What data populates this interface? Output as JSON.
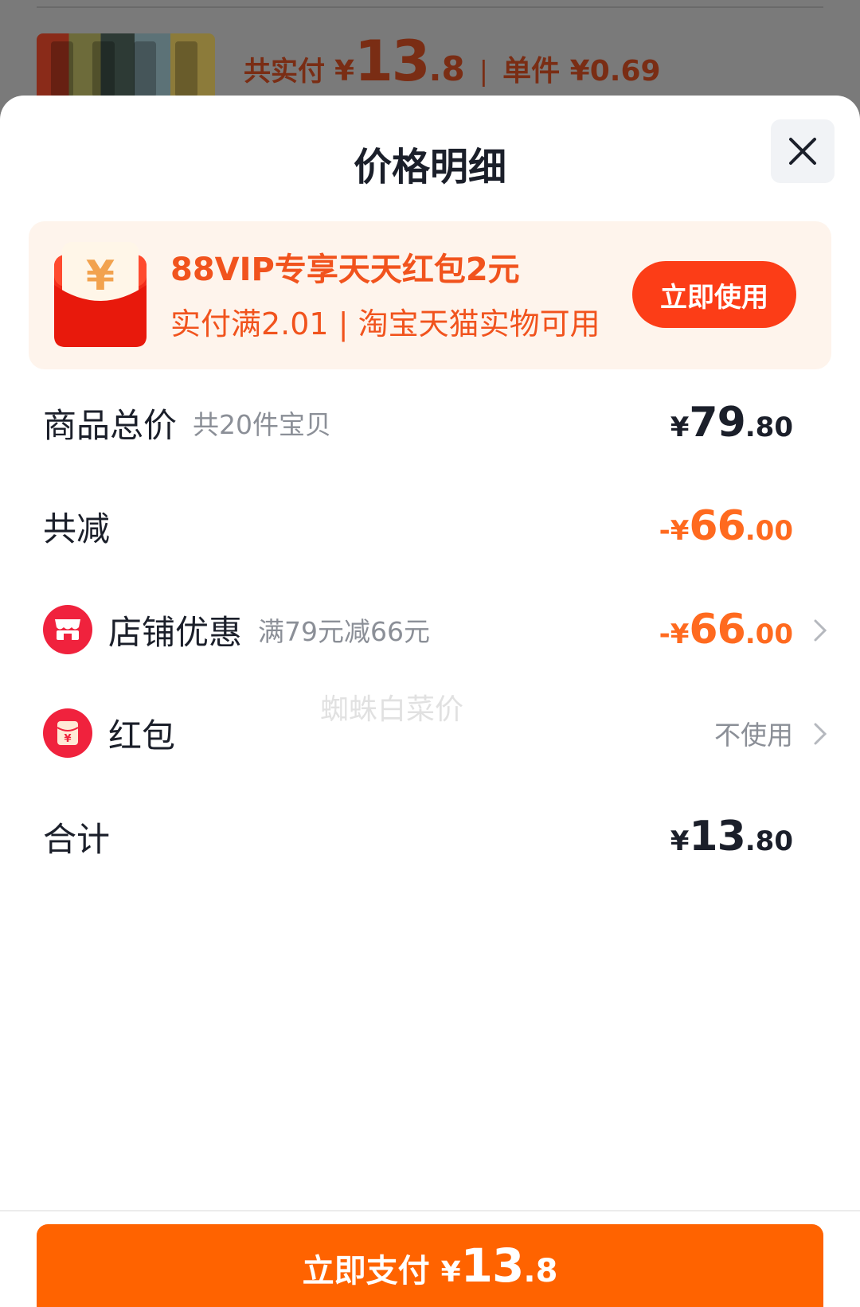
{
  "background_page": {
    "total_paid_label": "共实付",
    "currency": "¥",
    "total_int": "13",
    "total_dec": ".8",
    "separator": "|",
    "unit_label": "单件 ¥0.69"
  },
  "sheet": {
    "title": "价格明细"
  },
  "vip_banner": {
    "title": "88VIP专享天天红包2元",
    "subtitle": "实付满2.01 | 淘宝天猫实物可用",
    "button_label": "立即使用"
  },
  "rows": {
    "goods_total": {
      "label": "商品总价",
      "sub": "共20件宝贝",
      "currency": "¥",
      "int": "79",
      "dec": ".80"
    },
    "total_discount": {
      "label": "共减",
      "currency": "-¥",
      "int": "66",
      "dec": ".00"
    },
    "store_discount": {
      "label": "店铺优惠",
      "sub": "满79元减66元",
      "currency": "-¥",
      "int": "66",
      "dec": ".00"
    },
    "red_packet": {
      "label": "红包",
      "value": "不使用"
    },
    "sum": {
      "label": "合计",
      "currency": "¥",
      "int": "13",
      "dec": ".80"
    }
  },
  "watermark": "蜘蛛白菜价",
  "pay_button": {
    "label": "立即支付",
    "currency": "¥",
    "int": "13",
    "dec": ".8"
  },
  "colors": {
    "accent_orange": "#ff6300",
    "discount_orange": "#ff6a1f",
    "vip_red": "#fc3d17",
    "icon_red": "#f0223d"
  }
}
